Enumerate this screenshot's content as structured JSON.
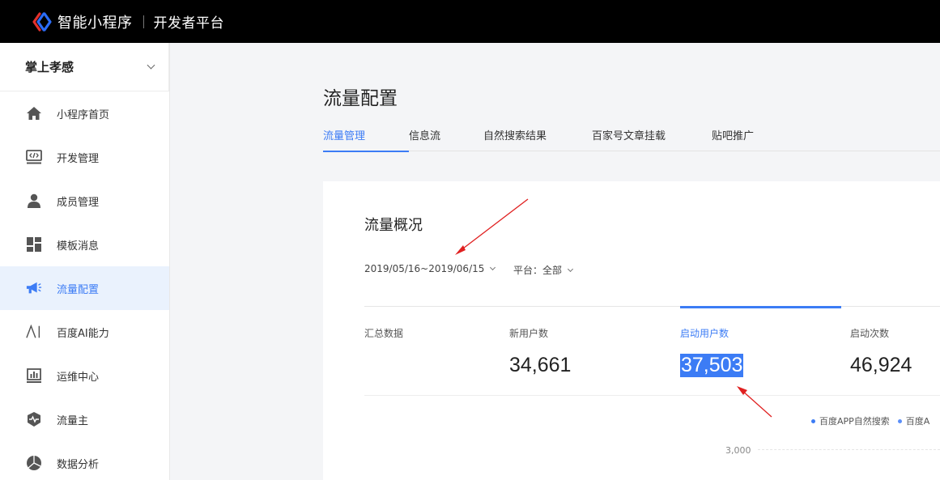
{
  "header": {
    "brand": "智能小程序",
    "platform": "开发者平台",
    "logo_icon": "baidu-smart-program-logo"
  },
  "sidebar": {
    "app_name": "掌上孝感",
    "items": [
      {
        "label": "小程序首页",
        "icon": "home-icon",
        "active": false
      },
      {
        "label": "开发管理",
        "icon": "code-icon",
        "active": false
      },
      {
        "label": "成员管理",
        "icon": "user-icon",
        "active": false
      },
      {
        "label": "模板消息",
        "icon": "template-icon",
        "active": false
      },
      {
        "label": "流量配置",
        "icon": "megaphone-icon",
        "active": true
      },
      {
        "label": "百度AI能力",
        "icon": "ai-icon",
        "active": false
      },
      {
        "label": "运维中心",
        "icon": "chart-bar-icon",
        "active": false
      },
      {
        "label": "流量主",
        "icon": "shield-pulse-icon",
        "active": false
      },
      {
        "label": "数据分析",
        "icon": "pie-chart-icon",
        "active": false
      }
    ]
  },
  "main": {
    "page_title": "流量配置",
    "tabs": [
      {
        "label": "流量管理",
        "active": true
      },
      {
        "label": "信息流",
        "active": false
      },
      {
        "label": "自然搜索结果",
        "active": false
      },
      {
        "label": "百家号文章挂载",
        "active": false
      },
      {
        "label": "贴吧推广",
        "active": false
      }
    ],
    "overview": {
      "title": "流量概况",
      "date_range": "2019/05/16~2019/06/15",
      "platform_filter": "平台：全部",
      "stats": [
        {
          "label": "汇总数据",
          "value": ""
        },
        {
          "label": "新用户数",
          "value": "34,661"
        },
        {
          "label": "启动用户数",
          "value": "37,503"
        },
        {
          "label": "启动次数",
          "value": "46,924"
        }
      ],
      "legend": [
        "百度APP自然搜索",
        "百度A"
      ],
      "ytick": "3,000"
    }
  },
  "colors": {
    "accent": "#3c7cf5",
    "annotation_arrow": "#e02020",
    "topbar": "#000000"
  }
}
